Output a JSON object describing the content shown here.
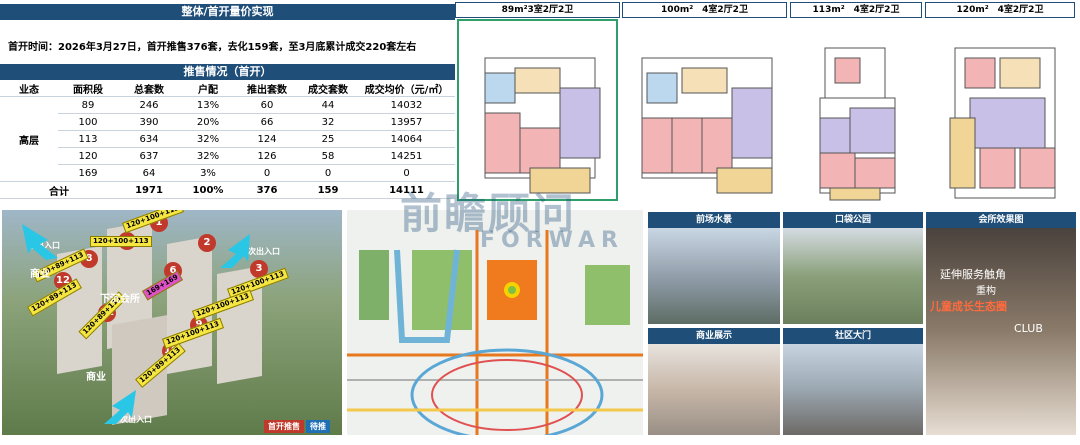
{
  "summary": {
    "title": "整体/首开量价实现",
    "text": "首开时间：2026年3月27日，首开推售376套，去化159套，至3月底累计成交220套左右"
  },
  "sales": {
    "title": "推售情况（首开）",
    "headers": [
      "业态",
      "面积段",
      "总套数",
      "户配",
      "推出套数",
      "成交套数",
      "成交均价（元/㎡）"
    ],
    "category": "高层",
    "rows": [
      [
        "89",
        "246",
        "13%",
        "60",
        "44",
        "14032"
      ],
      [
        "100",
        "390",
        "20%",
        "66",
        "32",
        "13957"
      ],
      [
        "113",
        "634",
        "32%",
        "124",
        "25",
        "14064"
      ],
      [
        "120",
        "637",
        "32%",
        "126",
        "58",
        "14251"
      ],
      [
        "169",
        "64",
        "3%",
        "0",
        "0",
        "0"
      ]
    ],
    "total": [
      "合计",
      "",
      "1971",
      "100%",
      "376",
      "159",
      "14111"
    ]
  },
  "floorplans": [
    {
      "title": "89m²3室2厅2卫"
    },
    {
      "title": "100m²　4室2厅2卫"
    },
    {
      "title": "113m²　4室2厅2卫"
    },
    {
      "title": "120m²　4室2厅2卫"
    }
  ],
  "siteplan": {
    "numbers": [
      "1",
      "2",
      "3",
      "6",
      "7",
      "8",
      "9",
      "10",
      "11",
      "12"
    ],
    "labels": [
      "120+100+113",
      "120+100+113",
      "120+100+113",
      "120+89+113",
      "120+89+113",
      "120+100+113",
      "120+100+113",
      "120+89+113",
      "120+89+113",
      "169+169"
    ],
    "text_labels": {
      "entry1": "主出入口",
      "entry2": "次出入口",
      "entry3": "次出入口",
      "commercial1": "商业",
      "commercial2": "商业",
      "club": "下沉会所"
    },
    "legend": {
      "launch": "首开推售",
      "pending": "待推"
    }
  },
  "watermark": {
    "cn": "前瞻顾问",
    "en": "FORWAR"
  },
  "photos": {
    "front_water": "前场水景",
    "pocket_park": "口袋公园",
    "club_effect": "会所效果图",
    "commercial": "商业展示",
    "gate": "社区大门",
    "club_text1": "延伸服务触角",
    "club_text2": "重构",
    "club_text3": "儿童成长生态圈",
    "club_text4": "CLUB"
  },
  "colors": {
    "navy": "#1f4e79",
    "red": "#c0392b",
    "yellow": "#f5e642",
    "cyan": "#29c6e6",
    "orange": "#e8781e"
  }
}
